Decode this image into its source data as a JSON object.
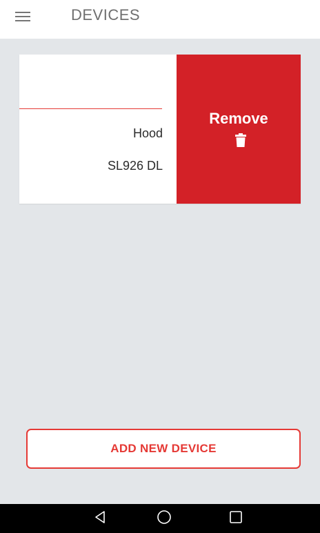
{
  "header": {
    "title": "DEVICES",
    "menu_icon": "hamburger-menu-icon"
  },
  "device": {
    "type": "Hood",
    "model": "SL926 DL",
    "remove_label": "Remove",
    "remove_icon": "trash-icon"
  },
  "add_button": {
    "label": "ADD NEW DEVICE"
  },
  "nav_bar": {
    "back_icon": "back-triangle-icon",
    "home_icon": "home-circle-icon",
    "recent_icon": "recent-apps-square-icon"
  },
  "colors": {
    "accent": "#e53935",
    "remove_bg": "#d32127",
    "background": "#e3e6e9",
    "title_text": "#6f6f6f"
  }
}
